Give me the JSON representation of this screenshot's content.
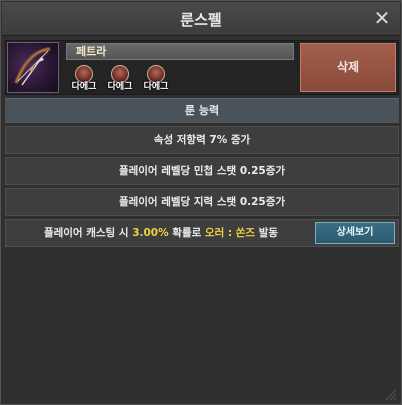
{
  "window": {
    "title": "룬스펠"
  },
  "item": {
    "name": "페트라",
    "skills": [
      {
        "label": "다에그"
      },
      {
        "label": "다에그"
      },
      {
        "label": "다에그"
      }
    ],
    "delete_label": "삭제"
  },
  "section": {
    "header": "룬 능력"
  },
  "effects": [
    {
      "text": "속성 저항력 7% 증가"
    },
    {
      "text": "플레이어 레벨당 민첩 스탯 0.25증가"
    },
    {
      "text": "플레이어 레벨당 지력 스탯 0.25증가"
    }
  ],
  "proc": {
    "prefix": "플레이어 캐스팅 시 ",
    "chance": "3.00%",
    "middle": " 확률로 ",
    "spell": "오러 : 쏜즈",
    "suffix": " 발동",
    "detail_label": "상세보기"
  },
  "colors": {
    "highlight": "#f1d140",
    "delete_button": "#a25f4d",
    "detail_button": "#3a6f86",
    "section_header": "#4a525a"
  },
  "icons": {
    "close": "close-icon",
    "portrait": "crossbow-icon",
    "skill": "rune-skill-icon",
    "resize": "resize-grip-icon"
  }
}
